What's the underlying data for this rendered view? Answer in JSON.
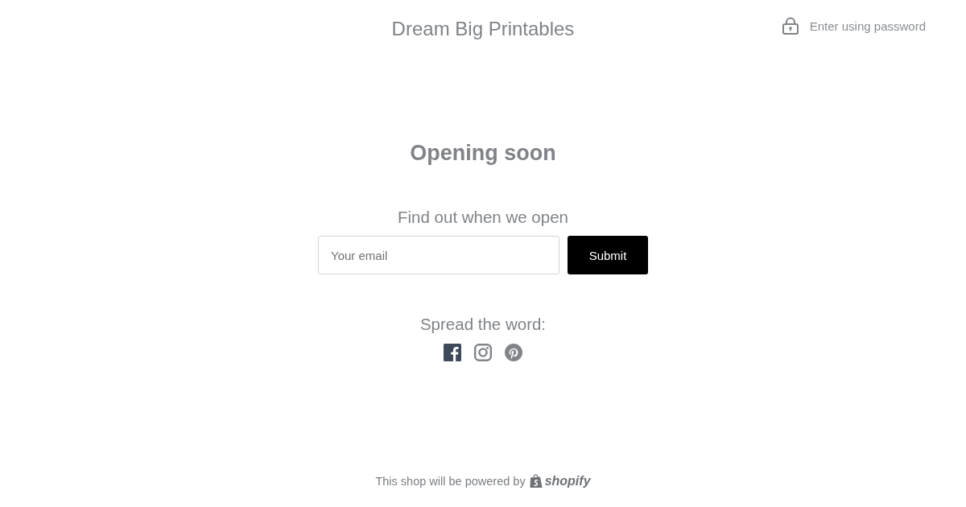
{
  "header": {
    "title": "Dream Big Printables",
    "password_link": "Enter using password"
  },
  "main": {
    "heading": "Opening soon",
    "subheading": "Find out when we open",
    "email_field": {
      "placeholder": "Your email"
    },
    "submit_button": "Submit",
    "share_heading": "Spread the word:",
    "social_links": [
      {
        "kind": "facebook",
        "color": "#3e4a59"
      },
      {
        "kind": "instagram",
        "color": "#818589"
      },
      {
        "kind": "pinterest",
        "color": "#818589"
      }
    ]
  },
  "footer": {
    "text": "This shop will be powered by",
    "brand": "shopify"
  }
}
